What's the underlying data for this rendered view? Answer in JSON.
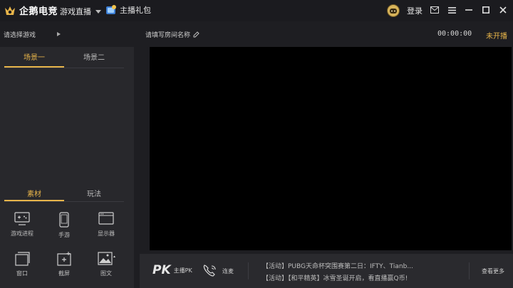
{
  "app": {
    "name": "企鹅电竞",
    "mode_label": "游戏直播",
    "gift_label": "主播礼包",
    "login_label": "登录"
  },
  "subbar": {
    "game_select": "请选择游戏",
    "room_name_placeholder": "请填写房间名称",
    "timer": "00:00:00",
    "status": "未开播"
  },
  "scene_tabs": [
    "场景一",
    "场景二"
  ],
  "material_tabs": [
    "素材",
    "玩法"
  ],
  "materials": [
    {
      "label": "游戏进程",
      "icon": "gamepad-monitor-icon"
    },
    {
      "label": "手游",
      "icon": "phone-icon"
    },
    {
      "label": "显示器",
      "icon": "monitor-icon"
    },
    {
      "label": "窗口",
      "icon": "window-icon"
    },
    {
      "label": "截屏",
      "icon": "screenshot-icon"
    },
    {
      "label": "图文",
      "icon": "image-icon"
    }
  ],
  "bottom": {
    "pk_mark": "PK",
    "pk_label": "主播PK",
    "lianmai_label": "连麦",
    "news": [
      "【活动】PUBG天命杯突围赛第二日：IFTY、Tianb...",
      "【活动】【和平精英】冰雪圣诞开启，看直播赢Q币!"
    ],
    "more_label": "查看更多"
  },
  "colors": {
    "accent": "#e8b54a",
    "background": "#1e1e22",
    "panel": "#28282c",
    "preview": "#000000"
  }
}
